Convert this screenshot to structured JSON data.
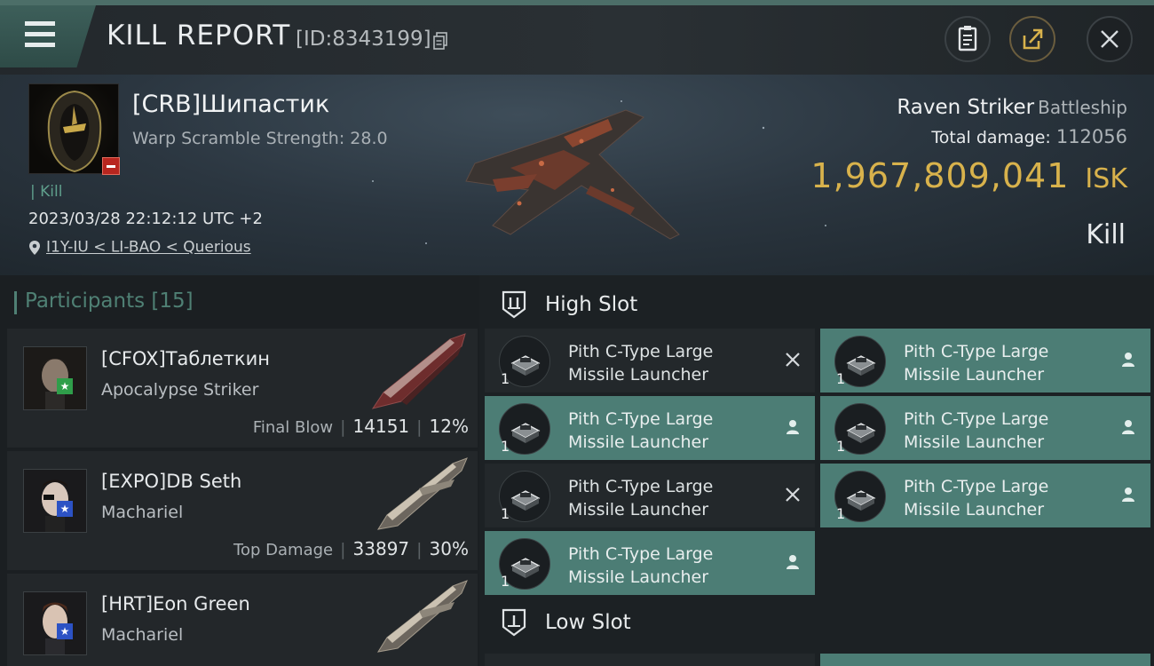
{
  "topbar": {
    "title": "KILL REPORT",
    "kill_id": "[ID:8343199]",
    "menu_icon": "menu-icon",
    "actions": [
      "clipboard-icon",
      "share-icon",
      "close-icon"
    ]
  },
  "victim": {
    "name": "[CRB]Шипастик",
    "scramble": "Warp Scramble Strength: 28.0",
    "kill_tag": "| Kill",
    "datetime": "2023/03/28 22:12:12 UTC +2",
    "location": "I1Y-IU < LI-BAO < Querious",
    "ship_name": "Raven Striker",
    "ship_class": "Battleship",
    "damage_label": "Total damage:",
    "damage_value": "112056",
    "isk_value": "1,967,809,041",
    "isk_unit": "ISK",
    "result": "Kill"
  },
  "participants": {
    "title": "Participants [15]",
    "items": [
      {
        "name": "[CFOX]Таблеткин",
        "ship": "Apocalypse Striker",
        "label": "Final Blow",
        "damage": "14151",
        "percent": "12%"
      },
      {
        "name": "[EXPO]DB Seth",
        "ship": "Machariel",
        "label": "Top Damage",
        "damage": "33897",
        "percent": "30%"
      },
      {
        "name": "[HRT]Eon Green",
        "ship": "Machariel",
        "label": "",
        "damage": "",
        "percent": ""
      }
    ]
  },
  "fitting": {
    "high_slot_title": "High Slot",
    "low_slot_title": "Low Slot",
    "high_slot": [
      {
        "line1": "Pith C-Type Large",
        "line2": "Missile Launcher",
        "qty": "1",
        "state": "destroyed"
      },
      {
        "line1": "Pith C-Type Large",
        "line2": "Missile Launcher",
        "qty": "1",
        "state": "dropped"
      },
      {
        "line1": "Pith C-Type Large",
        "line2": "Missile Launcher",
        "qty": "1",
        "state": "dropped"
      },
      {
        "line1": "Pith C-Type Large",
        "line2": "Missile Launcher",
        "qty": "1",
        "state": "dropped"
      },
      {
        "line1": "Pith C-Type Large",
        "line2": "Missile Launcher",
        "qty": "1",
        "state": "destroyed"
      },
      {
        "line1": "Pith C-Type Large",
        "line2": "Missile Launcher",
        "qty": "1",
        "state": "dropped"
      },
      {
        "line1": "Pith C-Type Large",
        "line2": "Missile Launcher",
        "qty": "1",
        "state": "dropped"
      }
    ]
  },
  "colors": {
    "accent": "#4c7d75",
    "isk": "#d8b24c",
    "danger": "#b8261f"
  }
}
